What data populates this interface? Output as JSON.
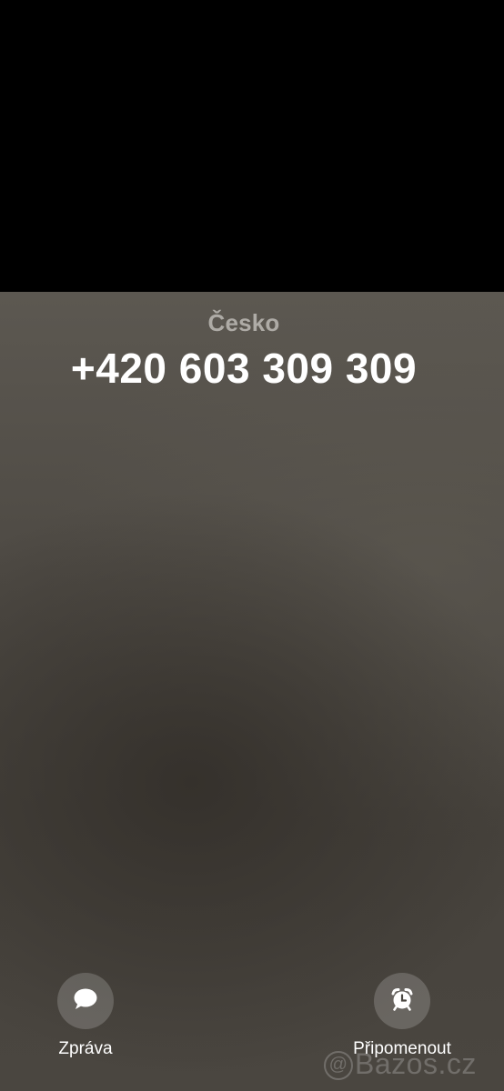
{
  "call": {
    "region": "Česko",
    "number": "+420 603 309 309"
  },
  "actions": {
    "message": {
      "label": "Zpráva",
      "icon": "message-bubble-icon"
    },
    "remind": {
      "label": "Připomenout",
      "icon": "alarm-clock-icon"
    }
  },
  "watermark": {
    "text": "Bazos.cz"
  },
  "colors": {
    "top_background": "#000000",
    "call_background": "#4e4a44",
    "region_text": "#aeaba6",
    "number_text": "#ffffff",
    "button_fill": "rgba(255,255,255,0.18)"
  }
}
